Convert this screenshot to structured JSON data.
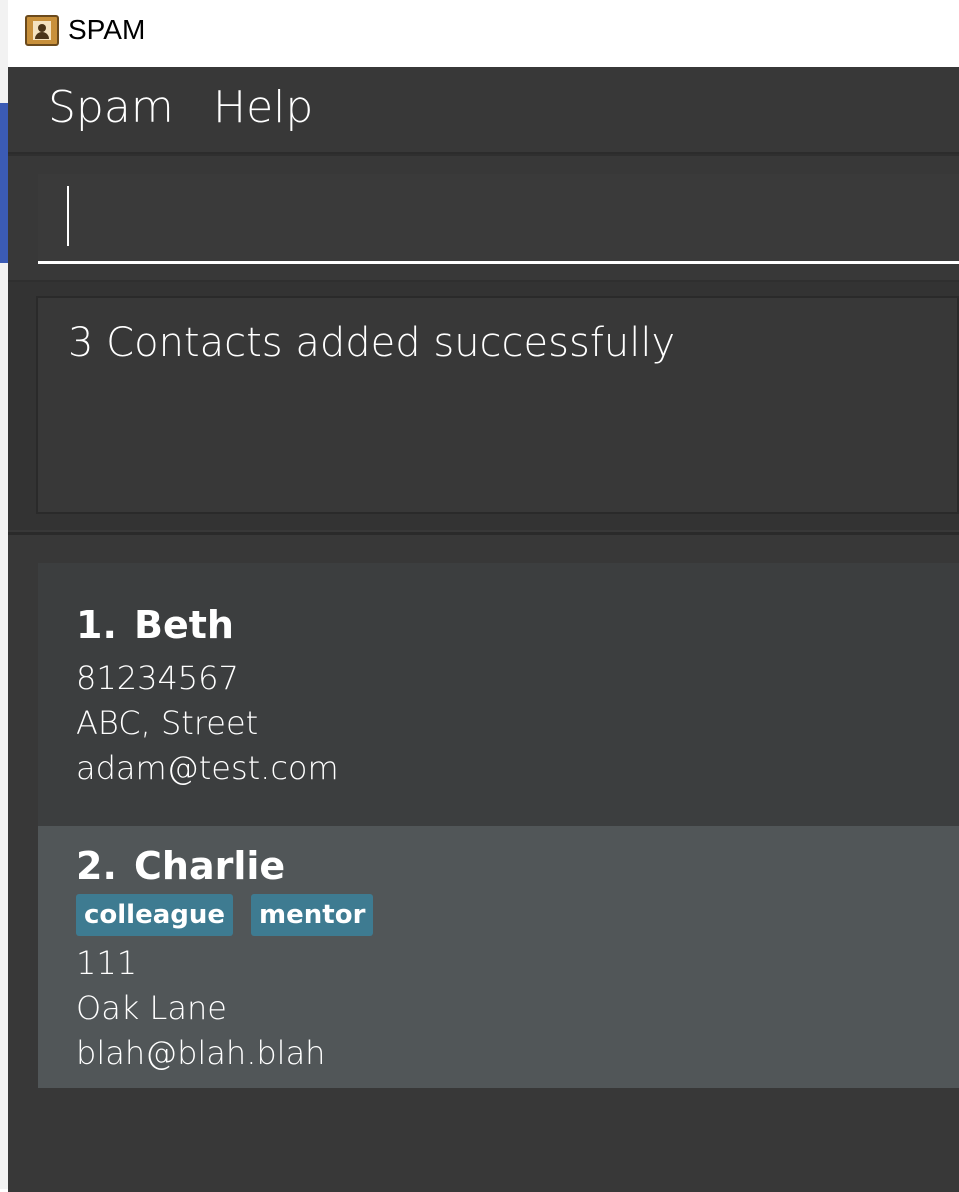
{
  "window": {
    "title": "SPAM",
    "icon": "contact-book-icon"
  },
  "menu": {
    "items": [
      "Spam",
      "Help"
    ]
  },
  "command": {
    "value": "",
    "placeholder": ""
  },
  "result": {
    "message": "3 Contacts added successfully"
  },
  "contacts": [
    {
      "index": "1.",
      "name": "Beth",
      "tags": [],
      "phone": "81234567",
      "address": "ABC, Street",
      "email": "adam@test.com"
    },
    {
      "index": "2.",
      "name": "Charlie",
      "tags": [
        "colleague",
        "mentor"
      ],
      "phone": "111",
      "address": "Oak Lane",
      "email": "blah@blah.blah"
    }
  ],
  "colors": {
    "background": "#383838",
    "selected_card": "#515658",
    "tag": "#3e7b91"
  }
}
